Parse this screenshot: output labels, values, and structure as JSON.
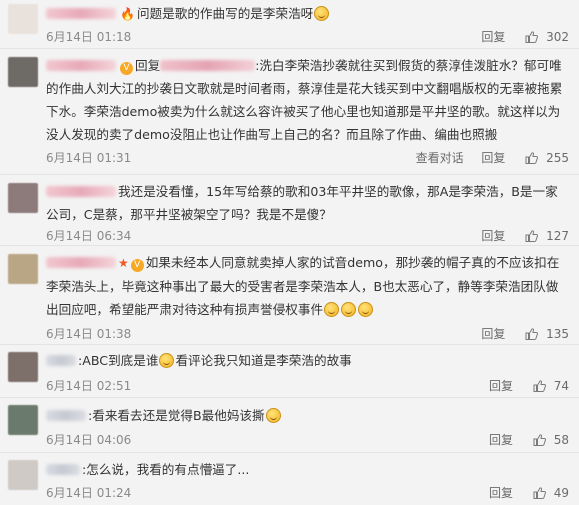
{
  "comments": [
    {
      "text": "问题是歌的作曲写的是李荣浩呀",
      "date": "6月14日 01:18",
      "reply_label": "回复",
      "likes": "302",
      "avatar_color": "#e9e2dc"
    },
    {
      "reply_prefix": "回复",
      "text": ":洗白李荣浩抄袭就往买到假货的蔡淳佳泼脏水？郁可唯的作曲人刘大江的抄袭日文歌就是时间者雨，蔡淳佳是花大钱买到中文翻唱版权的无辜被拖累下水。李荣浩demo被卖为什么就这么容许被买了他心里也知道那是平井坚的歌。就这样以为没人发现的卖了demo没阻止也让作曲写上自己的名？而且除了作曲、编曲也照搬",
      "date": "6月14日 01:31",
      "view_label": "查看对话",
      "reply_label": "回复",
      "likes": "255",
      "avatar_color": "#6e6a66"
    },
    {
      "text": "我还是没看懂，15年写给蔡的歌和03年平井坚的歌像，那A是李荣浩，B是一家公司，C是蔡，那平井坚被架空了吗？我是不是傻？",
      "date": "6月14日 06:34",
      "reply_label": "回复",
      "likes": "127",
      "avatar_color": "#8c7b7a"
    },
    {
      "text": "如果未经本人同意就卖掉人家的试音demo，那抄袭的帽子真的不应该扣在李荣浩头上，毕竟这种事出了最大的受害者是李荣浩本人，B也太恶心了，静等李荣浩团队做出回应吧，希望能严肃对待这种有损声誉侵权事件",
      "date": "6月14日 01:38",
      "reply_label": "回复",
      "likes": "135",
      "avatar_color": "#b9a685"
    },
    {
      "text": ":ABC到底是谁",
      "text_after": "看评论我只知道是李荣浩的故事",
      "date": "6月14日 02:51",
      "reply_label": "回复",
      "likes": "74",
      "avatar_color": "#7d6f6a"
    },
    {
      "text": ":看来看去还是觉得B最他妈该撕",
      "date": "6月14日 04:06",
      "reply_label": "回复",
      "likes": "58",
      "avatar_color": "#6a7a6d"
    },
    {
      "text": ":怎么说，我看的有点懵逼了...",
      "date": "6月14日 01:24",
      "reply_label": "回复",
      "likes": "49",
      "avatar_color": "#cfcac6"
    }
  ],
  "icons": {
    "fire": "🔥",
    "v_badge": "V",
    "star": "★"
  }
}
